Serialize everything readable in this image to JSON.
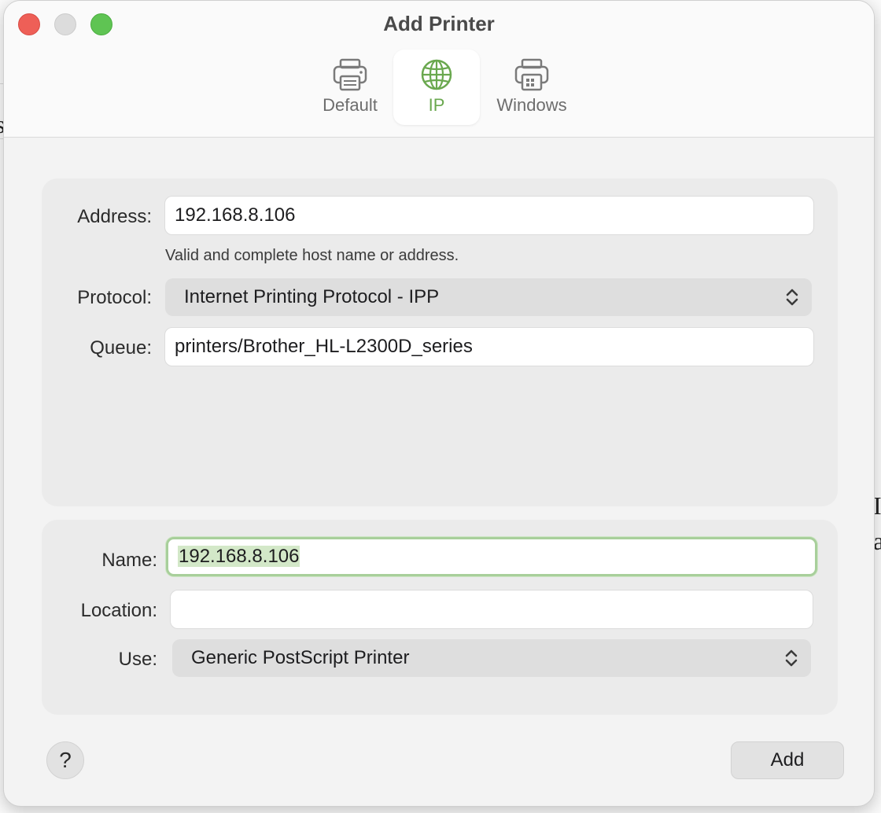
{
  "window": {
    "title": "Add Printer"
  },
  "tabs": [
    {
      "label": "Default",
      "icon": "printer-icon"
    },
    {
      "label": "IP",
      "icon": "globe-icon",
      "selected": true
    },
    {
      "label": "Windows",
      "icon": "windows-printer-icon"
    }
  ],
  "form": {
    "address": {
      "label": "Address:",
      "value": "192.168.8.106",
      "hint": "Valid and complete host name or address."
    },
    "protocol": {
      "label": "Protocol:",
      "value": "Internet Printing Protocol - IPP"
    },
    "queue": {
      "label": "Queue:",
      "value": "printers/Brother_HL-L2300D_series"
    },
    "name": {
      "label": "Name:",
      "value": "192.168.8.106"
    },
    "location": {
      "label": "Location:",
      "value": ""
    },
    "use": {
      "label": "Use:",
      "value": "Generic PostScript Printer"
    }
  },
  "buttons": {
    "help": "?",
    "add": "Add"
  },
  "colors": {
    "accent": "#6aa84f",
    "close": "#ee5f57",
    "maximize": "#5fc453"
  }
}
